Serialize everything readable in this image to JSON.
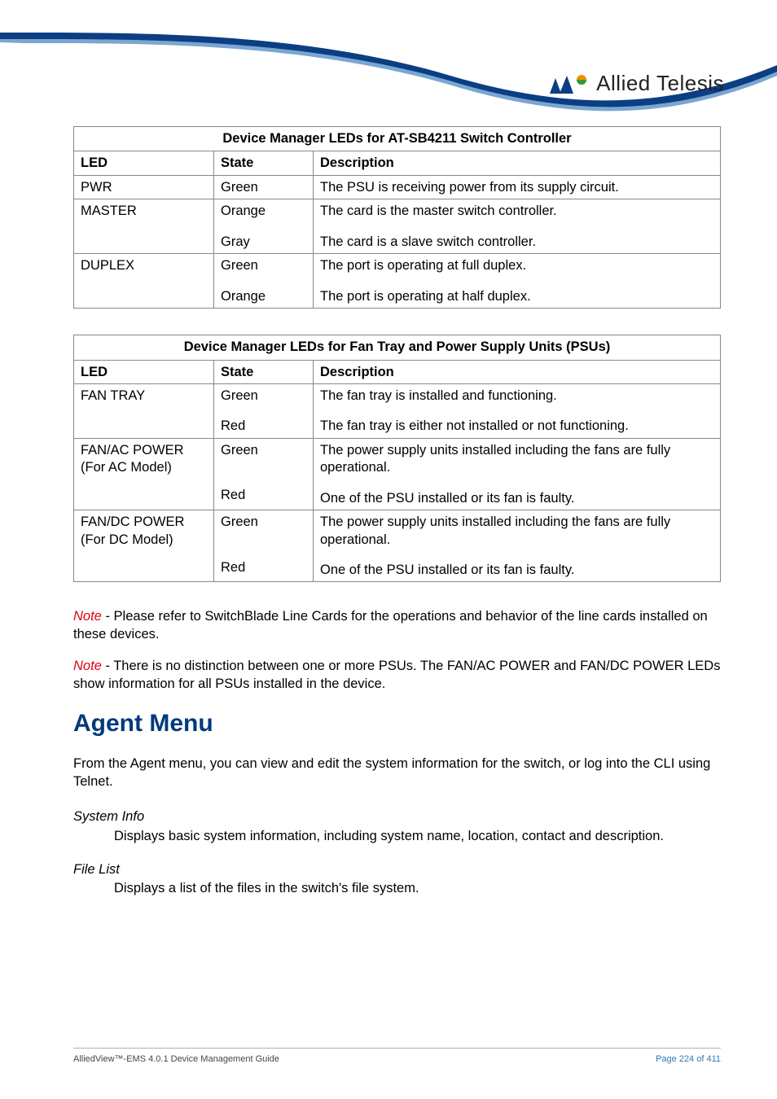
{
  "brand": {
    "name": "Allied Telesis"
  },
  "table1": {
    "caption": "Device Manager LEDs for AT-SB4211 Switch Controller",
    "head": {
      "led": "LED",
      "state": "State",
      "desc": "Description"
    },
    "rows": {
      "pwr": {
        "led": "PWR",
        "state": "Green",
        "desc": "The PSU is receiving power from its supply circuit."
      },
      "master": {
        "led": "MASTER",
        "state1": "Orange",
        "desc1": "The card is the master switch controller.",
        "state2": "Gray",
        "desc2": "The card is a slave switch controller."
      },
      "duplex": {
        "led": "DUPLEX",
        "state1": "Green",
        "desc1": "The port is operating at full duplex.",
        "state2": "Orange",
        "desc2": "The port is operating at half duplex."
      }
    }
  },
  "table2": {
    "caption": "Device Manager LEDs for Fan Tray and Power Supply Units (PSUs)",
    "head": {
      "led": "LED",
      "state": "State",
      "desc": "Description"
    },
    "rows": {
      "fantray": {
        "led": "FAN TRAY",
        "state1": "Green",
        "desc1": "The fan tray is installed and functioning.",
        "state2": "Red",
        "desc2": "The fan tray is either not installed or not functioning."
      },
      "fanac": {
        "led_l1": "FAN/AC POWER",
        "led_l2": "(For AC Model)",
        "state1": "Green",
        "desc1": "The power supply units installed including the fans are fully operational.",
        "state2": "Red",
        "desc2": "One of the PSU installed or its fan is faulty."
      },
      "fandc": {
        "led_l1": "FAN/DC POWER",
        "led_l2": "(For DC Model)",
        "state1": "Green",
        "desc1": "The power supply units installed including the fans are fully operational.",
        "state2": "Red",
        "desc2": "One of the PSU installed or its fan is faulty."
      }
    }
  },
  "notes": {
    "label": "Note",
    "n1": " - Please refer to SwitchBlade Line Cards for the operations and behavior of the line cards installed on these devices.",
    "n2": " - There is no distinction between one or more PSUs. The FAN/AC POWER and FAN/DC POWER LEDs show information for all PSUs installed in the device."
  },
  "agent": {
    "heading": "Agent Menu",
    "intro": "From the Agent menu, you can view and edit the system information for the switch, or log into the CLI using Telnet.",
    "items": {
      "sysinfo": {
        "term": "System Info",
        "body": "Displays basic system information, including system name, location, contact and description."
      },
      "filelist": {
        "term": "File List",
        "body": "Displays a list of the files in the switch's file system."
      }
    }
  },
  "footer": {
    "left": "AlliedView™-EMS 4.0.1 Device Management Guide",
    "right": "Page 224 of 411"
  }
}
